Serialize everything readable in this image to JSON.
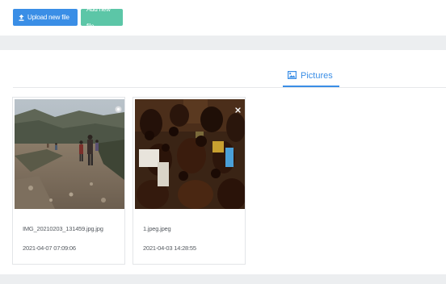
{
  "toolbar": {
    "upload_label": "Upload new file",
    "add_label": "Add new file"
  },
  "tabs": [
    {
      "label": "Pictures",
      "active": true,
      "icon": "image-icon"
    }
  ],
  "files": [
    {
      "name": "IMG_20210203_131459.jpg.jpg",
      "date": "2021-04-07 07:09:06",
      "thumbnail": "hikers on rocky trail",
      "remove_icon": "circle-icon"
    },
    {
      "name": "1.jpeg.jpeg",
      "date": "2021-04-03 14:28:55",
      "thumbnail": "crowd of people in dim room",
      "remove_icon": "close-icon"
    }
  ],
  "colors": {
    "primary": "#3a8ee6",
    "success": "#5cc6a7",
    "band": "#eceef0"
  }
}
